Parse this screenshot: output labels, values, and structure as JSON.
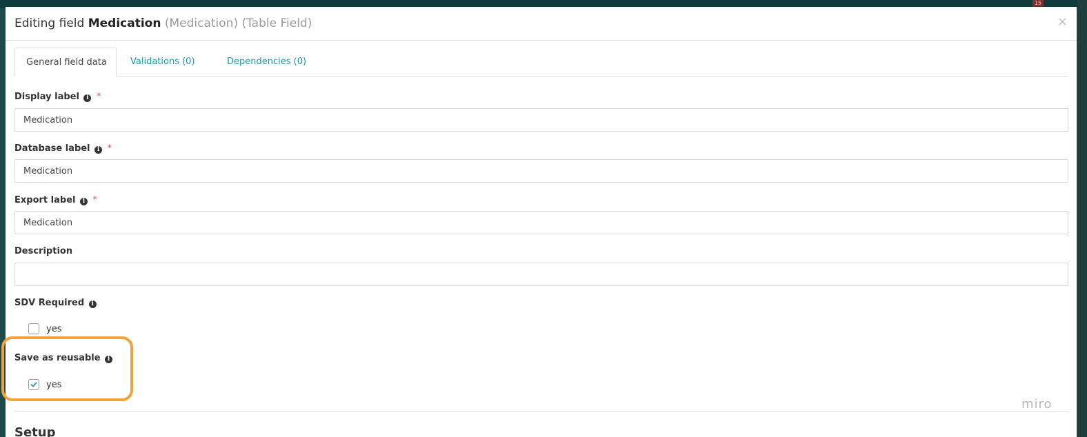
{
  "backdrop": {
    "badge": "15"
  },
  "modal": {
    "title_prefix": "Editing field",
    "title_name": "Medication",
    "title_db": "(Medication)",
    "title_type": "(Table Field)",
    "close": "×"
  },
  "tabs": [
    {
      "label": "General field data",
      "active": true
    },
    {
      "label": "Validations (0)",
      "active": false
    },
    {
      "label": "Dependencies (0)",
      "active": false
    }
  ],
  "fields": {
    "display_label": {
      "label": "Display label",
      "value": "Medication",
      "required": "*"
    },
    "database_label": {
      "label": "Database label",
      "value": "Medication",
      "required": "*"
    },
    "export_label": {
      "label": "Export label",
      "value": "Medication",
      "required": "*"
    },
    "description": {
      "label": "Description",
      "value": ""
    },
    "sdv_required": {
      "label": "SDV Required",
      "option": "yes",
      "checked": false
    },
    "save_reusable": {
      "label": "Save as reusable",
      "option": "yes",
      "checked": true
    }
  },
  "info_glyph": "i",
  "watermark": "miro",
  "section": {
    "title": "Setup"
  },
  "colors": {
    "accent": "#1a9aa8",
    "highlight": "#f2a23a",
    "required": "#d9534f"
  }
}
